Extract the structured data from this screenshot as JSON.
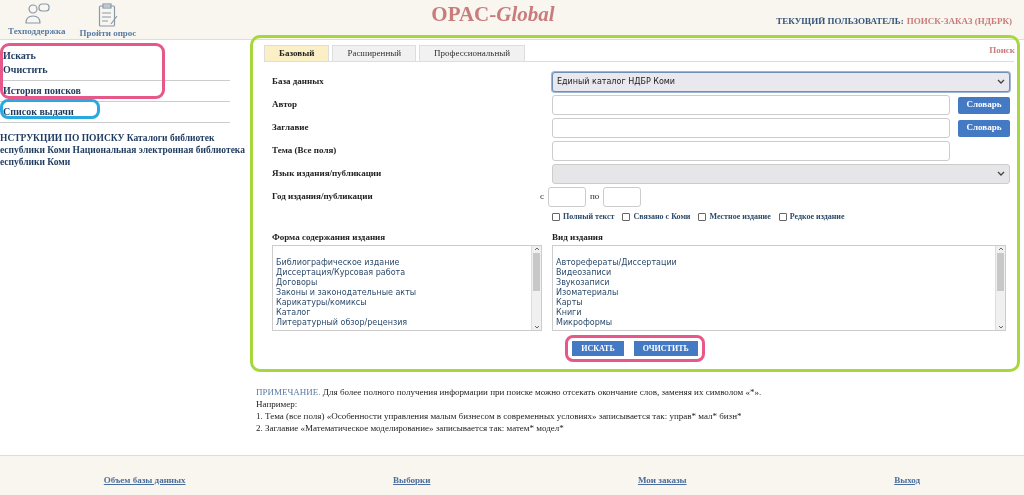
{
  "header": {
    "tools": [
      {
        "label": "Техподдержка",
        "kind": "support"
      },
      {
        "label": "Пройти опрос",
        "kind": "survey"
      }
    ],
    "title": {
      "plain": "OPAC-",
      "italic": "Global"
    },
    "user": {
      "label": "ТЕКУЩИЙ ПОЛЬЗОВАТЕЛЬ:",
      "value": "ПОИСК-ЗАКАЗ (НДБРК)"
    }
  },
  "sidebar": {
    "groups": [
      {
        "items": [
          "Искать",
          "Очистить"
        ]
      },
      {
        "items": [
          "История поисков"
        ]
      },
      {
        "items": [
          "Список выдачи"
        ]
      }
    ],
    "instructions": [
      "НСТРУКЦИИ ПО ПОИСКУ Каталоги библиотек",
      "еспублики Коми Национальная электронная библиотека",
      "еспублики Коми"
    ]
  },
  "search_panel": {
    "corner_label": "Поиск",
    "tabs": [
      {
        "label": "Базовый",
        "selected": true
      },
      {
        "label": "Расширенный",
        "selected": false
      },
      {
        "label": "Профессиональный",
        "selected": false
      }
    ],
    "fields": [
      {
        "kind": "select",
        "label": "База данных",
        "value": "Единый каталог НДБР Коми",
        "focused": true
      },
      {
        "kind": "text",
        "label": "Автор",
        "button": "Словарь"
      },
      {
        "kind": "text",
        "label": "Заглавие",
        "button": "Словарь"
      },
      {
        "kind": "text",
        "label": "Тема (Все поля)"
      },
      {
        "kind": "select",
        "label": "Язык издания/публикации",
        "focused": false
      },
      {
        "kind": "years",
        "label": "Год издания/публикации",
        "from_label": "с",
        "to_label": "по"
      }
    ],
    "checkboxes": [
      {
        "label": "Полный текст",
        "checked": false
      },
      {
        "label": "Связано с Коми",
        "checked": false
      },
      {
        "label": "Местное издание",
        "checked": false
      },
      {
        "label": "Редкое издание",
        "checked": false
      }
    ],
    "lists": [
      {
        "label": "Форма содержания издания",
        "items": [
          "Библиографическое издание",
          "Диссертация/Курсовая работа",
          "Договоры",
          "Законы и законодательные акты",
          "Карикатуры/комиксы",
          "Каталог",
          "Литературный обзор/рецензия"
        ]
      },
      {
        "label": "Вид издания",
        "items": [
          "Авторефераты/Диссертации",
          "Видеозаписи",
          "Звукозаписи",
          "Изоматериалы",
          "Карты",
          "Книги",
          "Микроформы"
        ]
      }
    ],
    "buttons": [
      "ИСКАТЬ",
      "ОЧИСТИТЬ"
    ]
  },
  "note": {
    "title": "ПРИМЕЧАНИЕ.",
    "text": "Для более полного получения информации при поиске можно отсекать окончание слов, заменяя их символом «*».",
    "lines": [
      "Например:",
      "1. Тема (все поля) «Особенности управления малым бизнесом в современных условиях» записывается так: управ* мал* бизн*",
      "2. Заглавие «Математическое моделирование» записывается так: матем* модел*"
    ]
  },
  "footer": {
    "links": [
      "Объем базы данных",
      "Выборки",
      "Мои заказы",
      "Выход"
    ]
  }
}
